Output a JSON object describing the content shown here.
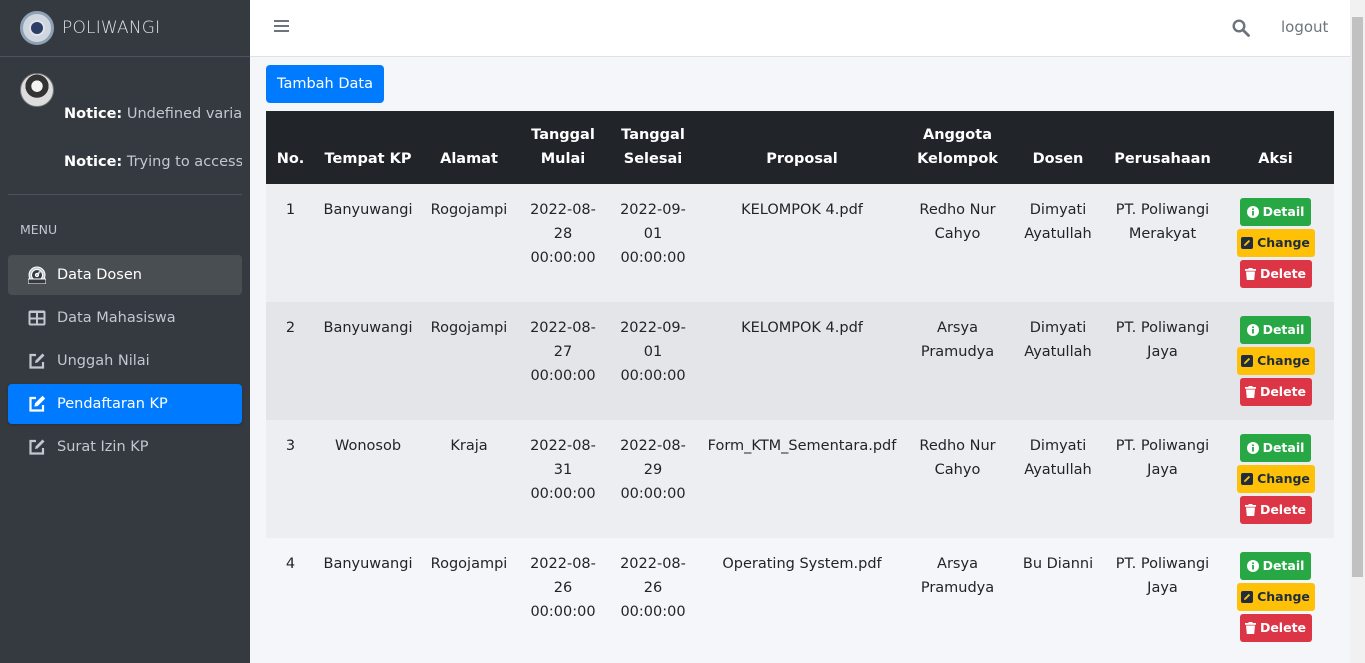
{
  "brand": {
    "title": "POLIWANGI"
  },
  "user_panel": {
    "notices": [
      {
        "label": "Notice:",
        "text": " Undefined variable"
      },
      {
        "label": "Notice:",
        "text": " Trying to access array"
      }
    ]
  },
  "sidebar": {
    "menu_header": "MENU",
    "items": [
      {
        "label": "Data Dosen",
        "icon": "dashboard-icon"
      },
      {
        "label": "Data Mahasiswa",
        "icon": "table-icon"
      },
      {
        "label": "Unggah Nilai",
        "icon": "edit-icon"
      },
      {
        "label": "Pendaftaran KP",
        "icon": "edit-icon"
      },
      {
        "label": "Surat Izin KP",
        "icon": "edit-icon"
      }
    ]
  },
  "topbar": {
    "logout_label": "logout"
  },
  "content": {
    "add_button": "Tambah Data"
  },
  "table": {
    "headers": {
      "no": "No.",
      "tempat_kp": "Tempat KP",
      "alamat": "Alamat",
      "tanggal_mulai": [
        "Tanggal",
        "Mulai"
      ],
      "tanggal_selesai": [
        "Tanggal",
        "Selesai"
      ],
      "proposal": "Proposal",
      "anggota": [
        "Anggota",
        "Kelompok"
      ],
      "dosen": "Dosen",
      "perusahaan": "Perusahaan",
      "aksi": "Aksi"
    },
    "actions": {
      "detail": "Detail",
      "change": "Change",
      "delete": "Delete"
    },
    "rows": [
      {
        "no": "1",
        "tempat": "Banyuwangi",
        "alamat": "Rogojampi",
        "mulai": [
          "2022-08-",
          "28",
          "00:00:00"
        ],
        "selesai": [
          "2022-09-",
          "01",
          "00:00:00"
        ],
        "proposal": "KELOMPOK 4.pdf",
        "anggota": [
          "Redho Nur",
          "Cahyo"
        ],
        "dosen": [
          "Dimyati",
          "Ayatullah"
        ],
        "perusahaan": [
          "PT. Poliwangi",
          "Merakyat"
        ]
      },
      {
        "no": "2",
        "tempat": "Banyuwangi",
        "alamat": "Rogojampi",
        "mulai": [
          "2022-08-",
          "27",
          "00:00:00"
        ],
        "selesai": [
          "2022-09-",
          "01",
          "00:00:00"
        ],
        "proposal": "KELOMPOK 4.pdf",
        "anggota": [
          "Arsya",
          "Pramudya"
        ],
        "dosen": [
          "Dimyati",
          "Ayatullah"
        ],
        "perusahaan": [
          "PT. Poliwangi",
          "Jaya"
        ]
      },
      {
        "no": "3",
        "tempat": "Wonosob",
        "alamat": "Kraja",
        "mulai": [
          "2022-08-",
          "31",
          "00:00:00"
        ],
        "selesai": [
          "2022-08-",
          "29",
          "00:00:00"
        ],
        "proposal": "Form_KTM_Sementara.pdf",
        "anggota": [
          "Redho Nur",
          "Cahyo"
        ],
        "dosen": [
          "Dimyati",
          "Ayatullah"
        ],
        "perusahaan": [
          "PT. Poliwangi",
          "Jaya"
        ]
      },
      {
        "no": "4",
        "tempat": "Banyuwangi",
        "alamat": "Rogojampi",
        "mulai": [
          "2022-08-",
          "26",
          "00:00:00"
        ],
        "selesai": [
          "2022-08-",
          "26",
          "00:00:00"
        ],
        "proposal": "Operating System.pdf",
        "anggota": [
          "Arsya",
          "Pramudya"
        ],
        "dosen": [
          "Bu Dianni"
        ],
        "perusahaan": [
          "PT. Poliwangi",
          "Jaya"
        ]
      }
    ]
  }
}
